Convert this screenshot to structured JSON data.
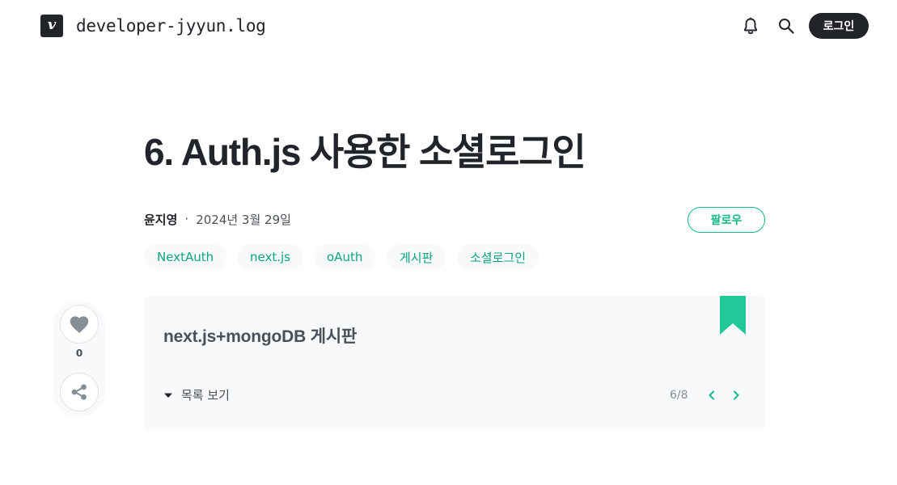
{
  "header": {
    "logo_letter": "v",
    "blog_name": "developer-jyyun.log",
    "login_label": "로그인"
  },
  "post": {
    "title": "6. Auth.js 사용한 소셜로그인",
    "author": "윤지영",
    "separator": "·",
    "date": "2024년 3월 29일",
    "follow_label": "팔로우",
    "tags": [
      "NextAuth",
      "next.js",
      "oAuth",
      "게시판",
      "소셜로그인"
    ]
  },
  "side": {
    "like_count": "0"
  },
  "series": {
    "title": "next.js+mongoDB 게시판",
    "toggle_label": "목록 보기",
    "page_indicator": "6/8"
  },
  "colors": {
    "accent": "#12b886",
    "text_dark": "#212529",
    "box_bg": "#f8f9fa"
  }
}
